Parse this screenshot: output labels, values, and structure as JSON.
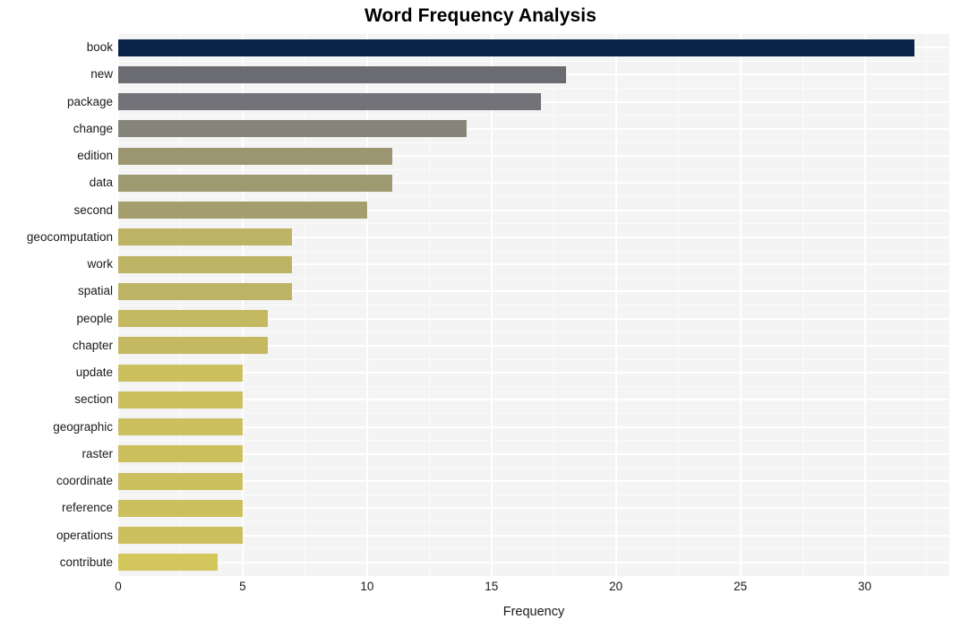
{
  "chart_data": {
    "type": "bar",
    "orientation": "horizontal",
    "title": "Word Frequency Analysis",
    "xlabel": "Frequency",
    "ylabel": "",
    "categories": [
      "book",
      "new",
      "package",
      "change",
      "edition",
      "data",
      "second",
      "geocomputation",
      "work",
      "spatial",
      "people",
      "chapter",
      "update",
      "section",
      "geographic",
      "raster",
      "coordinate",
      "reference",
      "operations",
      "contribute"
    ],
    "values": [
      32,
      18,
      17,
      14,
      11,
      11,
      10,
      7,
      7,
      7,
      6,
      6,
      5,
      5,
      5,
      5,
      5,
      5,
      5,
      4
    ],
    "bar_colors": [
      "#0a2349",
      "#6b6c71",
      "#727278",
      "#868579",
      "#9b9671",
      "#9e9970",
      "#a49e6e",
      "#bdb364",
      "#bdb364",
      "#bdb364",
      "#c4b961",
      "#c4b961",
      "#cbbf5e",
      "#cbbf5e",
      "#cbbf5e",
      "#cbbf5e",
      "#cbbf5e",
      "#cbbf5e",
      "#cbbf5e",
      "#d3c65c"
    ],
    "xlim": [
      0,
      33.4
    ],
    "xticks": [
      0,
      5,
      10,
      15,
      20,
      25,
      30
    ],
    "xtick_labels": [
      "0",
      "5",
      "10",
      "15",
      "20",
      "25",
      "30"
    ],
    "x_minor_ticks": [
      2.5,
      7.5,
      12.5,
      17.5,
      22.5,
      27.5,
      32.5
    ],
    "grid": true,
    "legend": "none",
    "panel_background": "#f4f4f4",
    "gridline_color": "#ffffff",
    "title_color": "#000000",
    "axis_text_color": "#1a1a1a"
  }
}
